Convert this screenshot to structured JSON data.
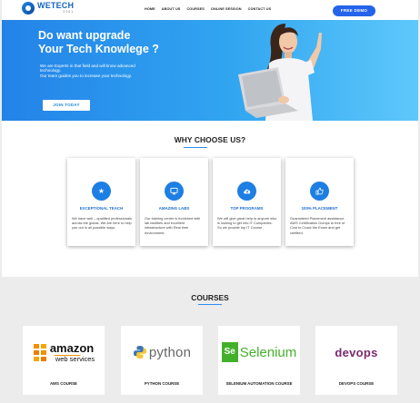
{
  "brand": {
    "name": "WETECH",
    "tagline": "2061"
  },
  "nav": {
    "items": [
      "HOME",
      "ABOUT US",
      "COURSES",
      "ONLINE SESSION",
      "CONTACT US"
    ],
    "demo_label": "FREE DEMO"
  },
  "hero": {
    "title_line1": "Do want upgrade",
    "title_line2": "Your Tech Knowlege ?",
    "desc_line1": "We are Experts in that field and will know advanced",
    "desc_line2": "technology.",
    "desc_line3": "Our team guides you to increase your technology.",
    "cta_label": "JOIN TODAY"
  },
  "why": {
    "title": "WHY CHOOSE US?",
    "cards": [
      {
        "icon": "star-icon",
        "title": "EXCEPTIONAL TEACH",
        "text": "We have well – qualified professionals across the global. We are here to help you out in all possible ways."
      },
      {
        "icon": "monitor-icon",
        "title": "AMAZING LABS",
        "text": "Our training center is furnished with lab facilities and excellent infrastructure with Real time environment."
      },
      {
        "icon": "cloud-upload-icon",
        "title": "TOP PROGRAMS",
        "text": "We will give great help to anyone who is looking to get into IT Companies. So we provide top IT Course ."
      },
      {
        "icon": "thumbs-up-icon",
        "title": "100% PLACEMENT",
        "text": "Guaranteed Placement assistance. AWS Certification Dumps to free of Cost to Crack the Exam and get certified."
      }
    ]
  },
  "courses": {
    "title": "COURSES",
    "items": [
      {
        "name": "AWS COURSE",
        "logo_main": "amazon",
        "logo_sub": "web services"
      },
      {
        "name": "PYTHON COURSE",
        "logo_main": "python"
      },
      {
        "name": "SELENIUM AUTOMATION COURSE",
        "logo_main": "Selenium",
        "logo_mark": "Se"
      },
      {
        "name": "DEVOPS COURSE",
        "logo_main": "devops"
      }
    ]
  },
  "colors": {
    "accent": "#2563eb",
    "hero_start": "#2383e8",
    "hero_end": "#5ec8fb",
    "card_title": "#1e6fcf"
  }
}
